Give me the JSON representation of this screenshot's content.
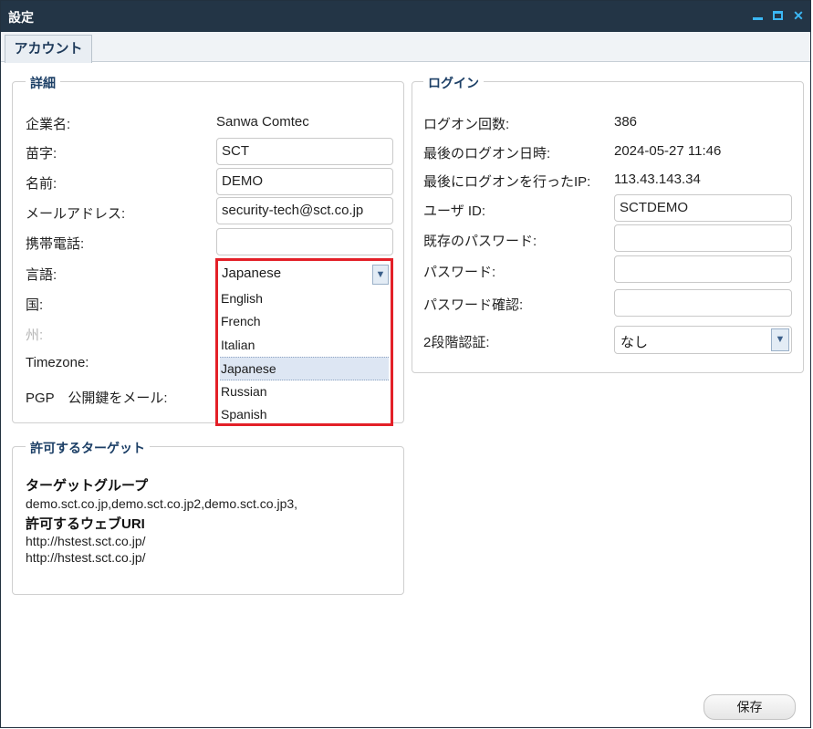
{
  "window": {
    "title": "設定"
  },
  "tabs": [
    {
      "label": "アカウント"
    }
  ],
  "details": {
    "legend": "詳細",
    "company": {
      "label": "企業名:",
      "value": "Sanwa Comtec"
    },
    "last_name": {
      "label": "苗字:",
      "value": "SCT"
    },
    "first_name": {
      "label": "名前:",
      "value": "DEMO"
    },
    "email": {
      "label": "メールアドレス:",
      "value": "security-tech@sct.co.jp"
    },
    "mobile": {
      "label": "携帯電話:",
      "value": ""
    },
    "language": {
      "label": "言語:",
      "selected": "Japanese",
      "options": [
        "English",
        "French",
        "Italian",
        "Japanese",
        "Russian",
        "Spanish"
      ]
    },
    "country": {
      "label": "国:"
    },
    "state": {
      "label": "州:"
    },
    "timezone": {
      "label": "Timezone:"
    },
    "pgp": {
      "label": "PGP　公開鍵をメール:"
    }
  },
  "login": {
    "legend": "ログイン",
    "logon_count": {
      "label": "ログオン回数:",
      "value": "386"
    },
    "last_logon": {
      "label": "最後のログオン日時:",
      "value": "2024-05-27 11:46"
    },
    "last_ip": {
      "label": "最後にログオンを行ったIP:",
      "value": "113.43.143.34"
    },
    "user_id": {
      "label": "ユーザ ID:",
      "value": "SCTDEMO"
    },
    "current_password": {
      "label": "既存のパスワード:",
      "value": ""
    },
    "password": {
      "label": "パスワード:",
      "value": ""
    },
    "password_confirm": {
      "label": "パスワード確認:",
      "value": ""
    },
    "two_factor": {
      "label": "2段階認証:",
      "value": "なし"
    }
  },
  "targets": {
    "legend": "許可するターゲット",
    "group_title": "ターゲットグループ",
    "groups": "demo.sct.co.jp,demo.sct.co.jp2,demo.sct.co.jp3,",
    "uri_title": "許可するウェブURI",
    "uris": [
      "http://hstest.sct.co.jp/",
      "http://hstest.sct.co.jp/"
    ]
  },
  "save_label": "保存",
  "colors": {
    "titlebar": "#233546",
    "accent": "#3bb7f4",
    "highlight": "#e32028",
    "legend": "#1c3f66"
  }
}
